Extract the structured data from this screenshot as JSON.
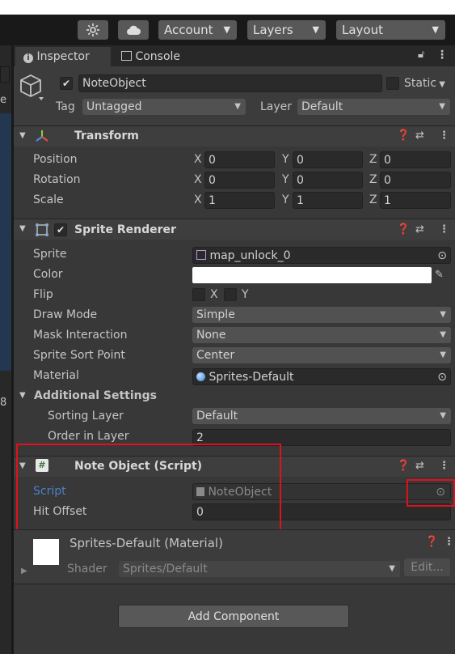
{
  "toolbar": {
    "buttons": [
      "Account",
      "Layers",
      "Layout"
    ],
    "collab_icon": "sun-gear-icon",
    "cloud_icon": "cloud-icon"
  },
  "tabs": {
    "inspector": "Inspector",
    "console": "Console"
  },
  "left_panel": {
    "fragments": [
      "e",
      "8"
    ]
  },
  "object": {
    "active": true,
    "name": "NoteObject",
    "static_label": "Static",
    "tag_label": "Tag",
    "tag_value": "Untagged",
    "layer_label": "Layer",
    "layer_value": "Default"
  },
  "transform": {
    "title": "Transform",
    "rows": [
      {
        "label": "Position",
        "x": "0",
        "y": "0",
        "z": "0"
      },
      {
        "label": "Rotation",
        "x": "0",
        "y": "0",
        "z": "0"
      },
      {
        "label": "Scale",
        "x": "1",
        "y": "1",
        "z": "1"
      }
    ],
    "axes": [
      "X",
      "Y",
      "Z"
    ]
  },
  "sprite_renderer": {
    "title": "Sprite Renderer",
    "sprite_label": "Sprite",
    "sprite_value": "map_unlock_0",
    "color_label": "Color",
    "color_value": "#ffffff",
    "flip_label": "Flip",
    "flip_x": "X",
    "flip_y": "Y",
    "draw_mode_label": "Draw Mode",
    "draw_mode_value": "Simple",
    "mask_label": "Mask Interaction",
    "mask_value": "None",
    "sort_point_label": "Sprite Sort Point",
    "sort_point_value": "Center",
    "material_label": "Material",
    "material_value": "Sprites-Default",
    "additional_label": "Additional Settings",
    "sorting_layer_label": "Sorting Layer",
    "sorting_layer_value": "Default",
    "order_label": "Order in Layer",
    "order_value": "2"
  },
  "note_object": {
    "title": "Note Object (Script)",
    "script_label": "Script",
    "script_value": "NoteObject",
    "hit_offset_label": "Hit Offset",
    "hit_offset_value": "0"
  },
  "material": {
    "title": "Sprites-Default (Material)",
    "shader_label": "Shader",
    "shader_value": "Sprites/Default",
    "edit_label": "Edit..."
  },
  "add_component": "Add Component",
  "colors": {
    "background": "#383838",
    "highlight_red": "#e0101c",
    "script_label_blue": "#4f7fc8"
  }
}
